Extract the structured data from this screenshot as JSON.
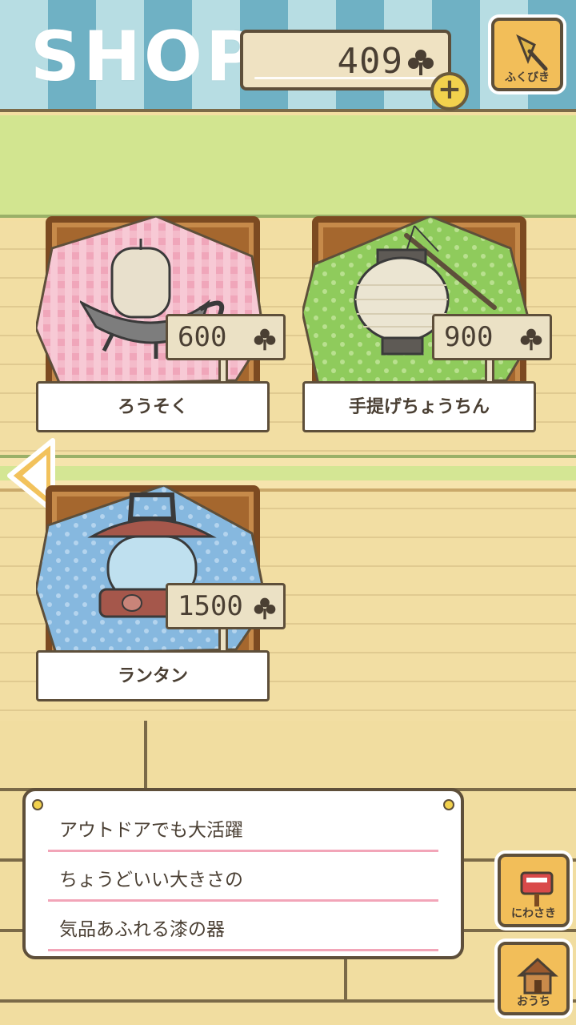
{
  "header": {
    "title": "SHOP",
    "clover_count": "409",
    "plus_label": "+",
    "lottery_label": "ふくびき"
  },
  "items": [
    {
      "name": "ろうそく",
      "price": "600",
      "cloth_color": "#f0a6ba"
    },
    {
      "name": "手提げちょうちん",
      "price": "900",
      "cloth_color": "#8fcb5c"
    },
    {
      "name": "ランタン",
      "price": "1500",
      "cloth_color": "#86b8df"
    }
  ],
  "description": {
    "lines": [
      "アウトドアでも大活躍",
      "ちょうどいい大きさの",
      "気品あふれる漆の器"
    ]
  },
  "nav": {
    "garden_label": "にわさき",
    "home_label": "おうち"
  },
  "colors": {
    "clover": "#4a3f33",
    "accent_yellow": "#f2d14d",
    "wood": "#f2dea3",
    "grass": "#d2e590",
    "sky_stripe": "#6fb1c4"
  }
}
